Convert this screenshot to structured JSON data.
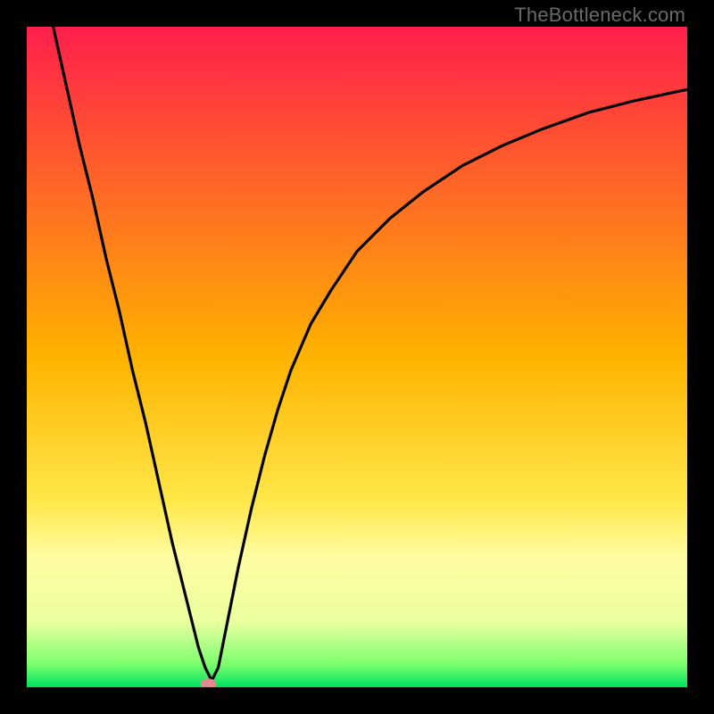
{
  "watermark": "TheBottleneck.com",
  "chart_data": {
    "type": "line",
    "title": "",
    "xlabel": "",
    "ylabel": "",
    "xlim": [
      0,
      100
    ],
    "ylim": [
      0,
      100
    ],
    "grid": false,
    "legend": false,
    "background_gradient": {
      "stops": [
        {
          "offset": 0.0,
          "color": "#ff1f4b"
        },
        {
          "offset": 0.5,
          "color": "#ffb300"
        },
        {
          "offset": 0.72,
          "color": "#ffe84a"
        },
        {
          "offset": 0.8,
          "color": "#fffca0"
        },
        {
          "offset": 0.9,
          "color": "#ecffa0"
        },
        {
          "offset": 0.965,
          "color": "#7cff6e"
        },
        {
          "offset": 1.0,
          "color": "#00e060"
        }
      ]
    },
    "series": [
      {
        "name": "bottleneck-curve",
        "x": [
          4,
          6,
          8,
          10,
          12,
          14,
          16,
          18,
          20,
          22,
          24,
          26,
          27,
          28,
          29,
          30,
          32,
          34,
          36,
          38,
          40,
          43,
          46,
          50,
          55,
          60,
          66,
          72,
          78,
          85,
          92,
          100
        ],
        "y": [
          100,
          91,
          82,
          74,
          65,
          57,
          48,
          40,
          31,
          22,
          14,
          6,
          3,
          1,
          3,
          8,
          18,
          27,
          35,
          42,
          48,
          55,
          60,
          66,
          71,
          75,
          79,
          82,
          84.5,
          87,
          88.8,
          90.5
        ]
      }
    ],
    "marker": {
      "x": 27.5,
      "y": 0.5,
      "color": "#e08a90"
    }
  }
}
